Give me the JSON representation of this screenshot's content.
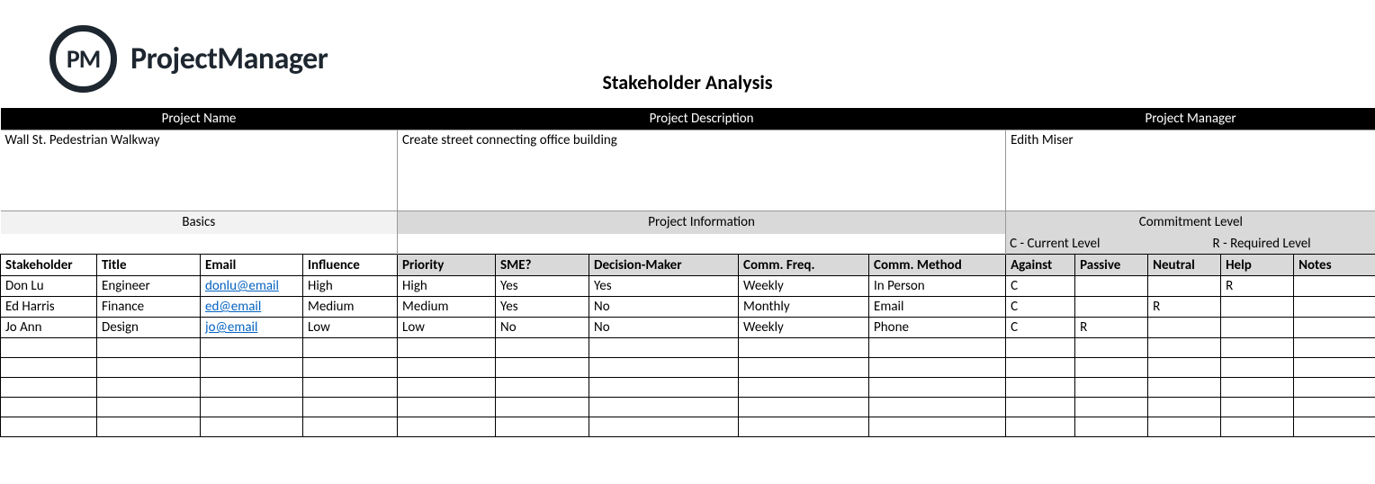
{
  "brand": {
    "logo_initials": "PM",
    "name": "ProjectManager"
  },
  "title": "Stakeholder Analysis",
  "meta_headers": {
    "project_name": "Project Name",
    "project_description": "Project Description",
    "project_manager": "Project Manager"
  },
  "meta_values": {
    "project_name": "Wall St. Pedestrian Walkway",
    "project_description": "Create street connecting office building",
    "project_manager": "Edith Miser"
  },
  "sections": {
    "basics": "Basics",
    "project_info": "Project Information",
    "commitment": "Commitment Level"
  },
  "legend": {
    "current": "C - Current Level",
    "required": "R - Required Level"
  },
  "columns": {
    "stakeholder": "Stakeholder",
    "title": "Title",
    "email": "Email",
    "influence": "Influence",
    "priority": "Priority",
    "sme": "SME?",
    "decision": "Decision-Maker",
    "freq": "Comm. Freq.",
    "method": "Comm. Method",
    "against": "Against",
    "passive": "Passive",
    "neutral": "Neutral",
    "help": "Help",
    "notes": "Notes"
  },
  "rows": [
    {
      "stakeholder": "Don Lu",
      "title": "Engineer",
      "email": "donlu@email",
      "influence": "High",
      "priority": "High",
      "sme": "Yes",
      "decision": "Yes",
      "freq": "Weekly",
      "method": "In Person",
      "against": "C",
      "passive": "",
      "neutral": "",
      "help": "R",
      "notes": ""
    },
    {
      "stakeholder": "Ed Harris",
      "title": "Finance",
      "email": "ed@email",
      "influence": "Medium",
      "priority": "Medium",
      "sme": "Yes",
      "decision": "No",
      "freq": "Monthly",
      "method": "Email",
      "against": "C",
      "passive": "",
      "neutral": "R",
      "help": "",
      "notes": ""
    },
    {
      "stakeholder": "Jo Ann",
      "title": "Design",
      "email": "jo@email",
      "influence": "Low",
      "priority": "Low",
      "sme": "No",
      "decision": "No",
      "freq": "Weekly",
      "method": "Phone",
      "against": "C",
      "passive": "R",
      "neutral": "",
      "help": "",
      "notes": ""
    },
    {
      "stakeholder": "",
      "title": "",
      "email": "",
      "influence": "",
      "priority": "",
      "sme": "",
      "decision": "",
      "freq": "",
      "method": "",
      "against": "",
      "passive": "",
      "neutral": "",
      "help": "",
      "notes": ""
    },
    {
      "stakeholder": "",
      "title": "",
      "email": "",
      "influence": "",
      "priority": "",
      "sme": "",
      "decision": "",
      "freq": "",
      "method": "",
      "against": "",
      "passive": "",
      "neutral": "",
      "help": "",
      "notes": ""
    },
    {
      "stakeholder": "",
      "title": "",
      "email": "",
      "influence": "",
      "priority": "",
      "sme": "",
      "decision": "",
      "freq": "",
      "method": "",
      "against": "",
      "passive": "",
      "neutral": "",
      "help": "",
      "notes": ""
    },
    {
      "stakeholder": "",
      "title": "",
      "email": "",
      "influence": "",
      "priority": "",
      "sme": "",
      "decision": "",
      "freq": "",
      "method": "",
      "against": "",
      "passive": "",
      "neutral": "",
      "help": "",
      "notes": ""
    },
    {
      "stakeholder": "",
      "title": "",
      "email": "",
      "influence": "",
      "priority": "",
      "sme": "",
      "decision": "",
      "freq": "",
      "method": "",
      "against": "",
      "passive": "",
      "neutral": "",
      "help": "",
      "notes": ""
    }
  ]
}
